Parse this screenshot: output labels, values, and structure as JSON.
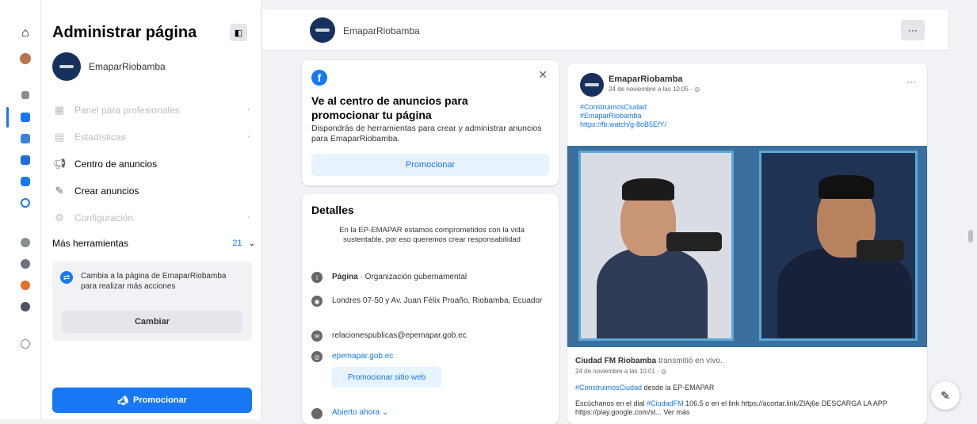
{
  "rail": {
    "icons": [
      "home-icon",
      "profile-avatar-icon",
      "grid-icon",
      "people-icon",
      "groups-icon",
      "marketplace-icon",
      "watch-icon",
      "clock-icon",
      "community-icon",
      "friends-icon",
      "games-icon",
      "photos-icon",
      "link-icon"
    ]
  },
  "sidebar": {
    "title": "Administrar página",
    "page_name": "EmaparRiobamba",
    "items": [
      {
        "label": "Panel para profesionales",
        "dim": true
      },
      {
        "label": "Estadísticas",
        "dim": true
      },
      {
        "label": "Centro de anuncios",
        "dim": false
      },
      {
        "label": "Crear anuncios",
        "dim": false
      },
      {
        "label": "Configuración",
        "dim": true
      }
    ],
    "more_tools": "Más herramientas",
    "more_count": "21",
    "switch_text": "Cambia a la página de EmaparRiobamba para realizar más acciones",
    "switch_button": "Cambiar",
    "promote_button": "Promocionar"
  },
  "topbar": {
    "page_name": "EmaparRiobamba",
    "more": "···"
  },
  "ads_card": {
    "heading": "Ve al centro de anuncios para promocionar tu página",
    "text": "Dispondrás de herramientas para crear y administrar anuncios para EmaparRiobamba.",
    "button": "Promocionar",
    "close": "✕"
  },
  "details": {
    "heading": "Detalles",
    "description": "En la EP-EMAPAR estamos comprometidos con la vida sustentable, por eso queremos crear responsabilidad",
    "category_label": "Página",
    "category": " · Organización gubernamental",
    "address": "Londres 07-50 y Av. Juan Félix Proaño, Riobamba, Ecuador",
    "email": "relacionespublicas@epemapar.gob.ec",
    "website": "epemapar.gob.ec",
    "website_button": "Promocionar sitio web",
    "open_status": "Abierto ahora ⌄"
  },
  "post": {
    "author": "EmaparRiobamba",
    "date": "24 de noviembre a las 10:05 · ◎",
    "more": "···",
    "tags": [
      "#ConstruimosCiudad",
      "#EmaparRiobamba",
      "https://fb.watch/g-8oB5EfY/"
    ],
    "shared_author": "Ciudad FM Riobamba",
    "shared_action": " transmitió en vivo.",
    "shared_date": "24 de noviembre a las 10:01 · ◎",
    "shared_tag": "#ConstruimosCiudad",
    "shared_tag_suffix": " desde la EP-EMAPAR",
    "shared_text": "Escúchanos en el dial ",
    "shared_text_link": "#CiudadFM",
    "shared_text_rest": " 106.5 o en el link https://acortar.link/ZlAj6e DESCARGA LA APP https://play.google.com/st... Ver más"
  },
  "colors": {
    "accent": "#1877f2",
    "page_avatar": "#16325c",
    "background": "#f0f2f5"
  }
}
